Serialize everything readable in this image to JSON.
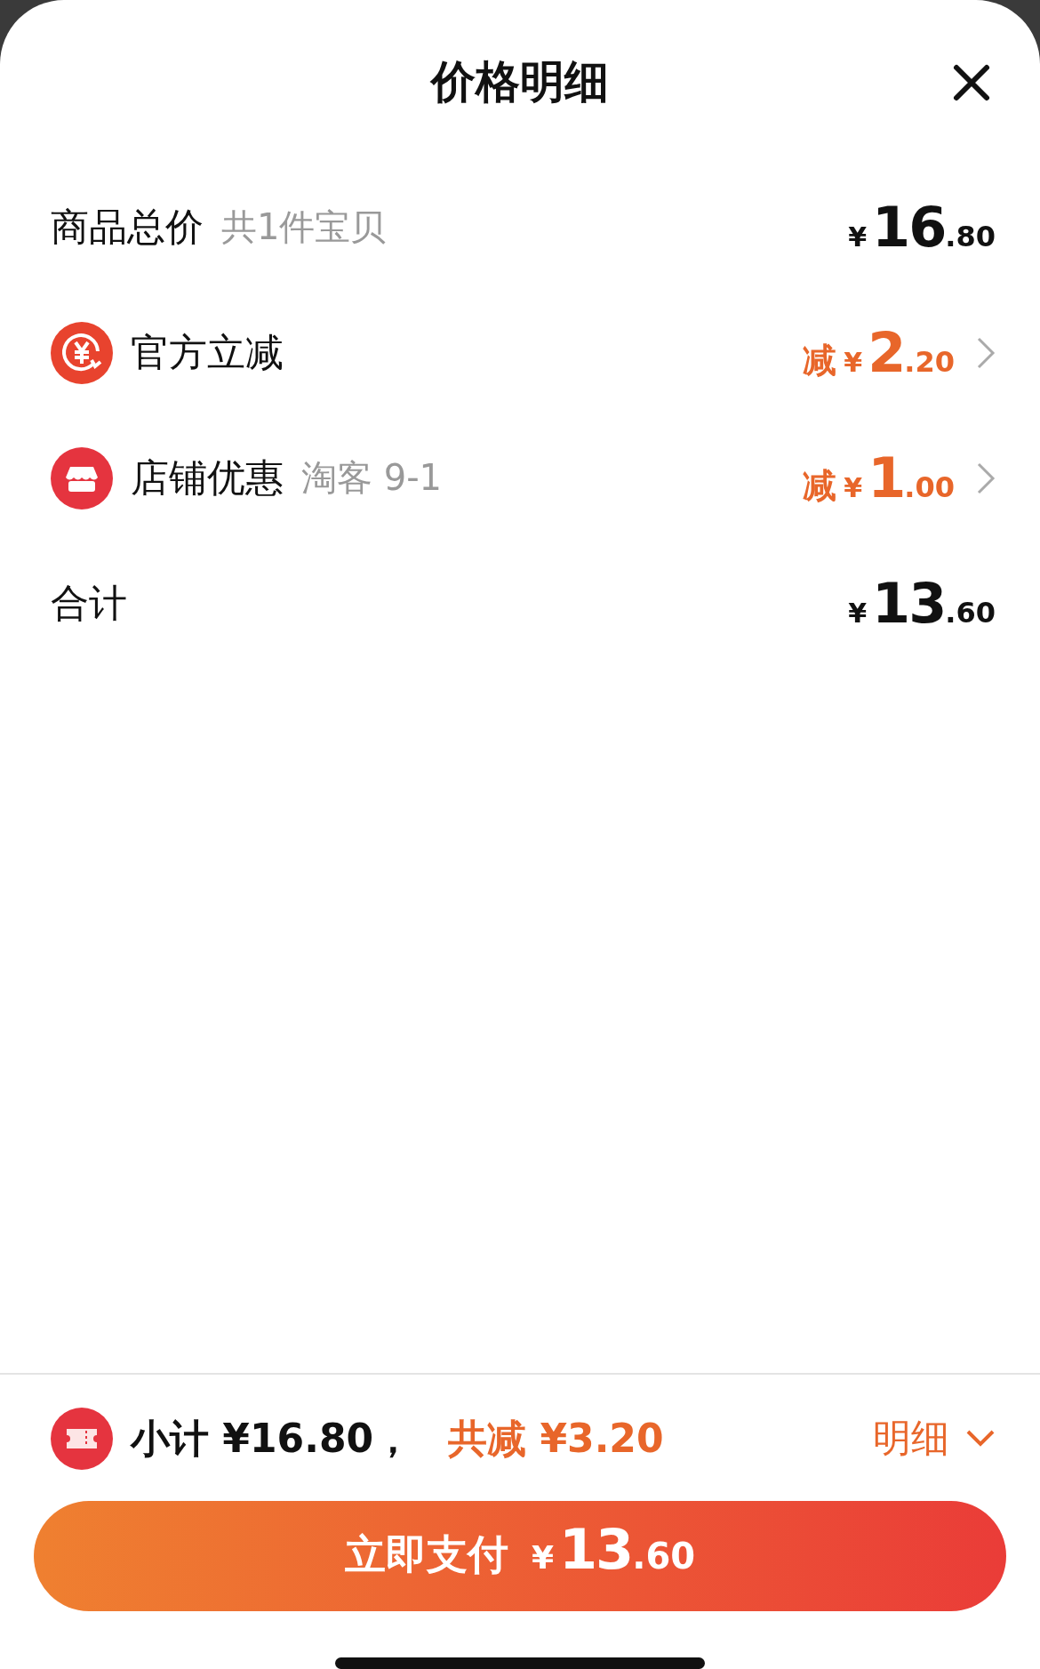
{
  "title": "价格明细",
  "rows": [
    {
      "kind": "total",
      "label": "商品总价",
      "note": "共1件宝贝",
      "price": {
        "symbol": "¥",
        "integer": "16",
        "decimal": ".80"
      }
    },
    {
      "kind": "discount",
      "label": "官方立减",
      "price": {
        "prefix": "减",
        "symbol": "¥",
        "integer": "2",
        "decimal": ".20"
      }
    },
    {
      "kind": "discount",
      "label": "店铺优惠",
      "note": "淘客 9-1",
      "price": {
        "prefix": "减",
        "symbol": "¥",
        "integer": "1",
        "decimal": ".00"
      }
    },
    {
      "kind": "total",
      "label": "合计",
      "price": {
        "symbol": "¥",
        "integer": "13",
        "decimal": ".60"
      }
    }
  ],
  "footer": {
    "subtotal": "小计 ¥16.80，",
    "saving": "共减 ¥3.20",
    "details": "明细",
    "expanded": false
  },
  "pay_button": {
    "label": "立即支付",
    "symbol": "¥",
    "integer": "13",
    "decimal": ".60"
  }
}
